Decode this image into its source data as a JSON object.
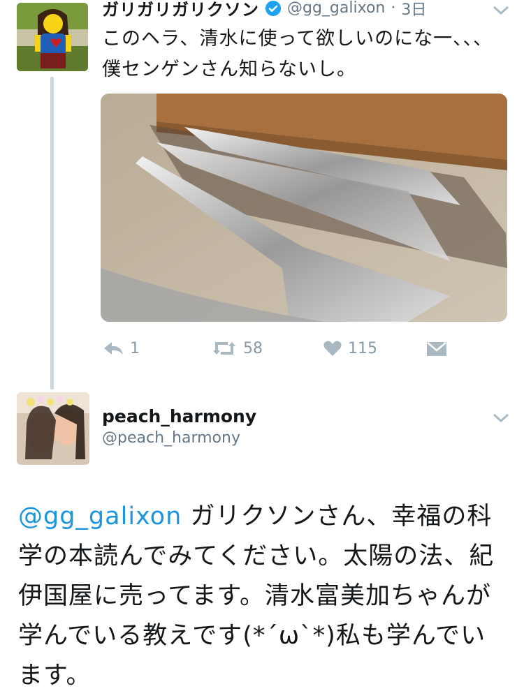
{
  "colors": {
    "accent": "#1b95e0",
    "muted": "#8899a6",
    "text": "#14171a",
    "verified": "#1da1f2"
  },
  "tweet1": {
    "display_name": "ガリガリガリクソン",
    "handle": "@gg_galixon",
    "separator": "·",
    "time": "3日",
    "verified_icon": "verified-badge-icon",
    "text": "このヘラ、清水に使って欲しいのにな一、、、僕センゲンさん知らないし。",
    "photo_icon": "spatulas-photo",
    "actions": {
      "reply_count": "1",
      "retweet_count": "58",
      "like_count": "115"
    }
  },
  "tweet2": {
    "display_name": "peach_harmony",
    "handle": "@peach_harmony",
    "mention": "@gg_galixon",
    "text": "ガリクソンさん、幸福の科学の本読んでみてください。太陽の法、紀伊国屋に売ってます。清水富美加ちゃんが学んでいる教えです(*´ω`*)私も学んでいます。"
  }
}
